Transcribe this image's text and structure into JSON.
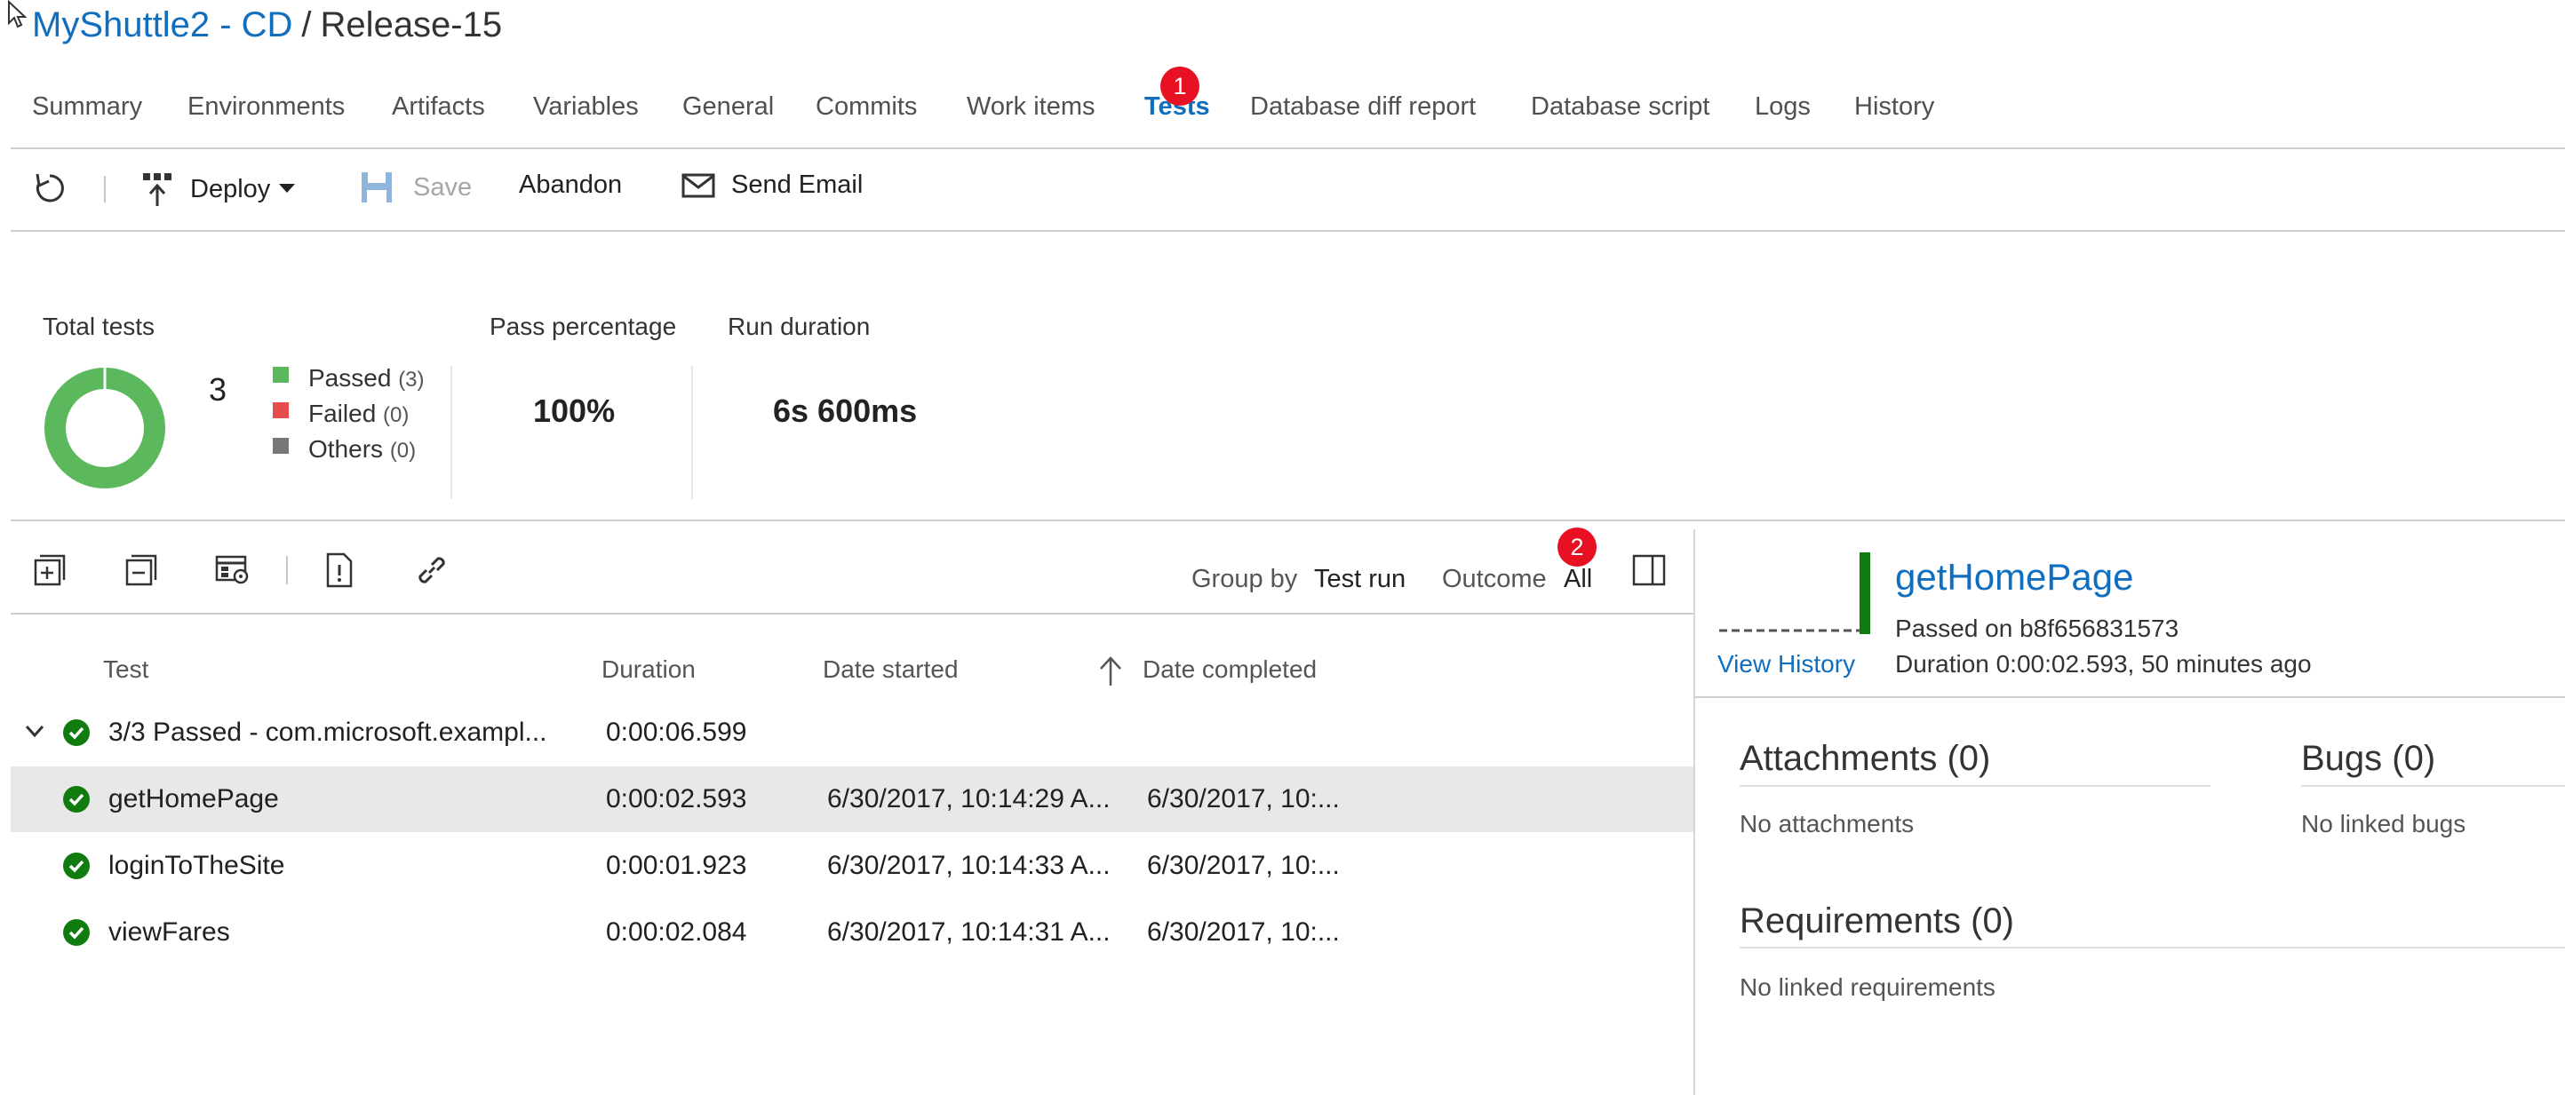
{
  "breadcrumb": {
    "project": "MyShuttle2 - CD",
    "separator": "/",
    "release": "Release-15"
  },
  "tabs": [
    {
      "label": "Summary"
    },
    {
      "label": "Environments"
    },
    {
      "label": "Artifacts"
    },
    {
      "label": "Variables"
    },
    {
      "label": "General"
    },
    {
      "label": "Commits"
    },
    {
      "label": "Work items"
    },
    {
      "label": "Tests",
      "active": true,
      "badge": "1"
    },
    {
      "label": "Database diff report"
    },
    {
      "label": "Database script"
    },
    {
      "label": "Logs"
    },
    {
      "label": "History"
    }
  ],
  "toolbar": {
    "refresh_icon": "refresh-icon",
    "deploy_label": "Deploy",
    "save_label": "Save",
    "abandon_label": "Abandon",
    "send_email_label": "Send Email"
  },
  "summary": {
    "total_tests_label": "Total tests",
    "total_count": "3",
    "legend": [
      {
        "label": "Passed",
        "count": "(3)",
        "color": "#5cb85c"
      },
      {
        "label": "Failed",
        "count": "(0)",
        "color": "#e74c4c"
      },
      {
        "label": "Others",
        "count": "(0)",
        "color": "#777777"
      }
    ],
    "pass_percentage_label": "Pass percentage",
    "pass_percentage_value": "100%",
    "run_duration_label": "Run duration",
    "run_duration_value": "6s 600ms"
  },
  "results_toolbar": {
    "group_by_label": "Group by",
    "group_by_value": "Test run",
    "outcome_label": "Outcome",
    "outcome_value": "All",
    "outcome_badge": "2"
  },
  "table": {
    "columns": [
      "Test",
      "Duration",
      "Date started",
      "Date completed"
    ],
    "group": {
      "name": "3/3 Passed - com.microsoft.exampl...",
      "duration": "0:00:06.599"
    },
    "rows": [
      {
        "name": "getHomePage",
        "duration": "0:00:02.593",
        "started": "6/30/2017, 10:14:29 A...",
        "completed": "6/30/2017, 10:...",
        "selected": true
      },
      {
        "name": "loginToTheSite",
        "duration": "0:00:01.923",
        "started": "6/30/2017, 10:14:33 A...",
        "completed": "6/30/2017, 10:..."
      },
      {
        "name": "viewFares",
        "duration": "0:00:02.084",
        "started": "6/30/2017, 10:14:31 A...",
        "completed": "6/30/2017, 10:..."
      }
    ]
  },
  "detail": {
    "title": "getHomePage",
    "passed_on": "Passed on b8f656831573",
    "duration": "Duration 0:00:02.593, 50 minutes ago",
    "view_history": "View History",
    "attachments_title": "Attachments (0)",
    "attachments_empty": "No attachments",
    "bugs_title": "Bugs (0)",
    "bugs_empty": "No linked bugs",
    "requirements_title": "Requirements (0)",
    "requirements_empty": "No linked requirements"
  },
  "colors": {
    "accent": "#106ebe",
    "pass": "#107c10",
    "badge": "#e81123"
  }
}
